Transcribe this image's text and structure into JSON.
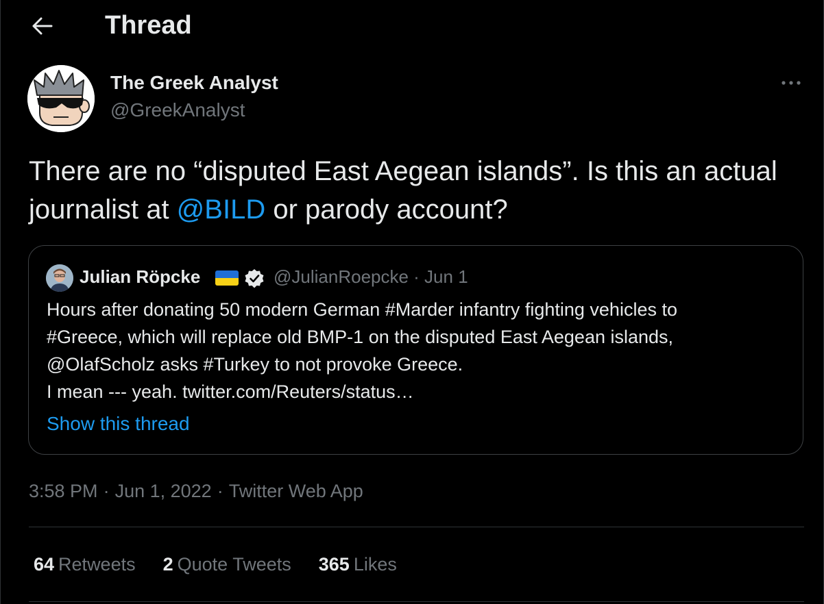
{
  "header": {
    "title": "Thread",
    "back_icon": "arrow-left-icon"
  },
  "author": {
    "name": "The Greek Analyst",
    "handle": "@GreekAnalyst",
    "avatar_icon": "cartoon-sunglasses-avatar"
  },
  "tweet": {
    "text_before": "There are no “disputed East Aegean islands”. Is this an actual journalist at ",
    "mention": "@BILD",
    "text_after": " or parody account?"
  },
  "quote": {
    "name": "Julian Röpcke",
    "flag": "ukraine-flag",
    "verified_icon": "verified-badge-icon",
    "handle_date": "@JulianRoepcke · Jun 1",
    "lines": [
      "Hours after donating 50 modern German #Marder infantry fighting vehicles to",
      "#Greece, which will replace old BMP-1 on the disputed East Aegean islands,",
      "@OlafScholz asks #Turkey to not provoke Greece.",
      "I mean --- yeah. twitter.com/Reuters/status…"
    ],
    "show_thread": "Show this thread"
  },
  "meta": {
    "time": "3:58 PM",
    "date": "Jun 1, 2022",
    "source": "Twitter Web App",
    "separator": "·"
  },
  "stats": [
    {
      "value": "64",
      "label": "Retweets"
    },
    {
      "value": "2",
      "label": "Quote Tweets"
    },
    {
      "value": "365",
      "label": "Likes"
    }
  ],
  "colors": {
    "background": "#000000",
    "text": "#e7e9ea",
    "secondary": "#71767b",
    "accent": "#1d9bf0",
    "border": "#2f3336"
  }
}
